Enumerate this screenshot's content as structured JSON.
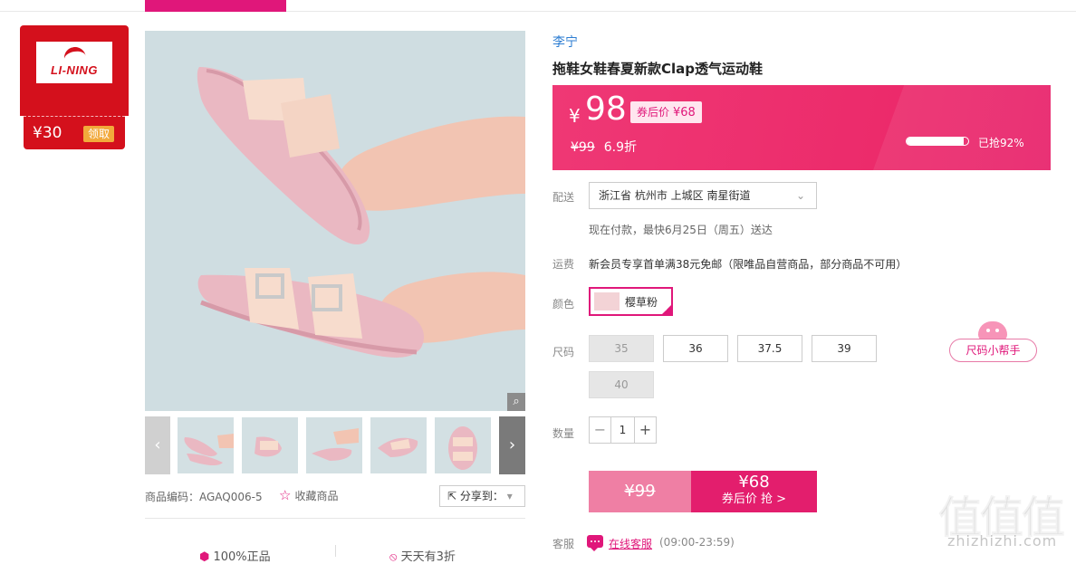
{
  "brand_badge": {
    "logo_text": "LI-NING",
    "coupon_amount": "¥30",
    "claim_label": "领取"
  },
  "product": {
    "brand": "李宁",
    "title": "拖鞋女鞋春夏新款Clap透气运动鞋",
    "code_label": "商品编码：AGAQ006-5",
    "favorite_label": "收藏商品",
    "share_label": "分享到：",
    "zoom_icon": "magnifier-icon",
    "nav_prev_icon": "chevron-left-icon",
    "nav_next_icon": "chevron-right-icon",
    "promises": [
      "100%正品",
      "天天有3折"
    ]
  },
  "price": {
    "currency": "¥",
    "current": "98",
    "after_coupon_label": "券后价",
    "after_coupon": "¥68",
    "original": "¥99",
    "discount": "6.9折",
    "sold_label": "已抢92%",
    "sold_fraction": 0.92
  },
  "delivery": {
    "label": "配送",
    "address": "浙江省 杭州市 上城区 南星街道",
    "eta": "现在付款，最快6月25日（周五）送达"
  },
  "shipping": {
    "label": "运费",
    "text": "新会员专享首单满38元免邮（限唯品自营商品，部分商品不可用）"
  },
  "color": {
    "label": "颜色",
    "options": [
      "樱草粉"
    ],
    "selected": "樱草粉"
  },
  "size": {
    "label": "尺码",
    "options": [
      {
        "value": "35",
        "available": false
      },
      {
        "value": "36",
        "available": true
      },
      {
        "value": "37.5",
        "available": true
      },
      {
        "value": "39",
        "available": true
      },
      {
        "value": "40",
        "available": false
      }
    ],
    "helper_label": "尺码小帮手"
  },
  "quantity": {
    "label": "数量",
    "value": "1",
    "minus": "−",
    "plus": "+"
  },
  "buy": {
    "original_price": "¥99",
    "coupon_price": "¥68",
    "action_label": "券后价 抢 >"
  },
  "service": {
    "label": "客服",
    "link": "在线客服",
    "hours": "(09:00-23:59)"
  },
  "watermark": {
    "big": "值值值",
    "small": "zhizhizhi.com"
  },
  "colors": {
    "accent": "#e0177a",
    "price_bg": "#ec2b6b",
    "brand_red": "#d4101c"
  }
}
